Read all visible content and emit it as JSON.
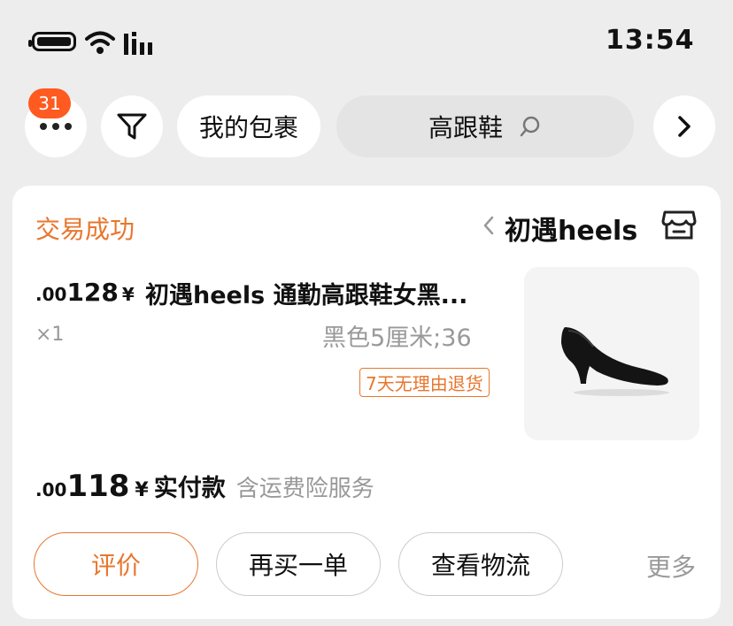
{
  "status_bar": {
    "time": "13:54"
  },
  "top_bar": {
    "badge_count": "31",
    "my_packages_label": "我的包裹",
    "search_text": "高跟鞋"
  },
  "order": {
    "status": "交易成功",
    "shop_name": "初遇heels",
    "product_title": "初遇heels 通勤高跟鞋女黑...",
    "price_currency": "¥",
    "price_int": "128",
    "price_dec": ".00",
    "spec": "黑色5厘米;36",
    "quantity": "×1",
    "return_tag": "7天无理由退货",
    "insurance_note": "含运费险服务",
    "paid_label": "实付款",
    "paid_currency": "¥",
    "paid_int": "118",
    "paid_dec": ".00"
  },
  "actions": {
    "more_label": "更多",
    "logistics_label": "查看物流",
    "buy_again_label": "再买一单",
    "review_label": "评价"
  },
  "colors": {
    "accent": "#e8762d",
    "badge": "#ff5a1f"
  }
}
